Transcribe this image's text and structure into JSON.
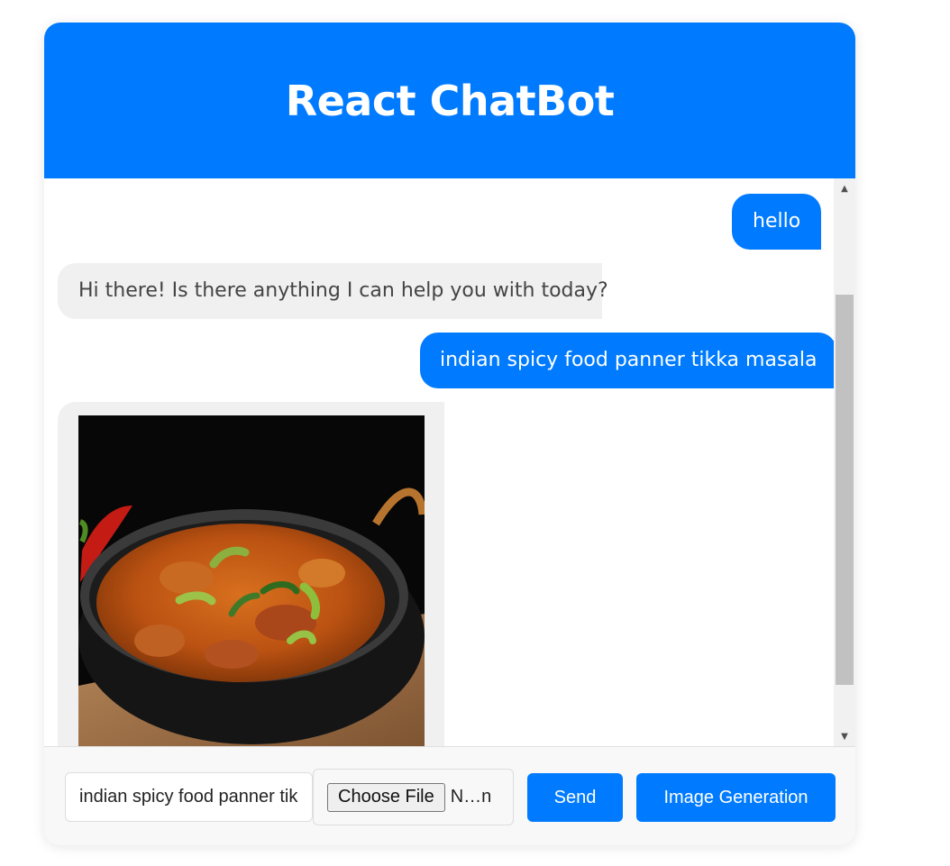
{
  "app": {
    "title": "React ChatBot"
  },
  "messages": [
    {
      "role": "user",
      "text": "hello"
    },
    {
      "role": "bot",
      "text": "Hi there! Is there anything I can help you with today?"
    },
    {
      "role": "user",
      "text": "indian spicy food panner tikka masala"
    },
    {
      "role": "bot",
      "type": "image"
    }
  ],
  "input": {
    "value": "indian spicy food panner tik"
  },
  "file": {
    "button_label": "Choose File",
    "file_name": "N…n"
  },
  "buttons": {
    "send": "Send",
    "image_generation": "Image Generation"
  },
  "colors": {
    "primary": "#007bff",
    "bot_bubble": "#f0f0f0",
    "panel": "#f8f8f8"
  },
  "icons": {
    "scroll_up": "triangle-up-icon",
    "scroll_down": "triangle-down-icon"
  }
}
